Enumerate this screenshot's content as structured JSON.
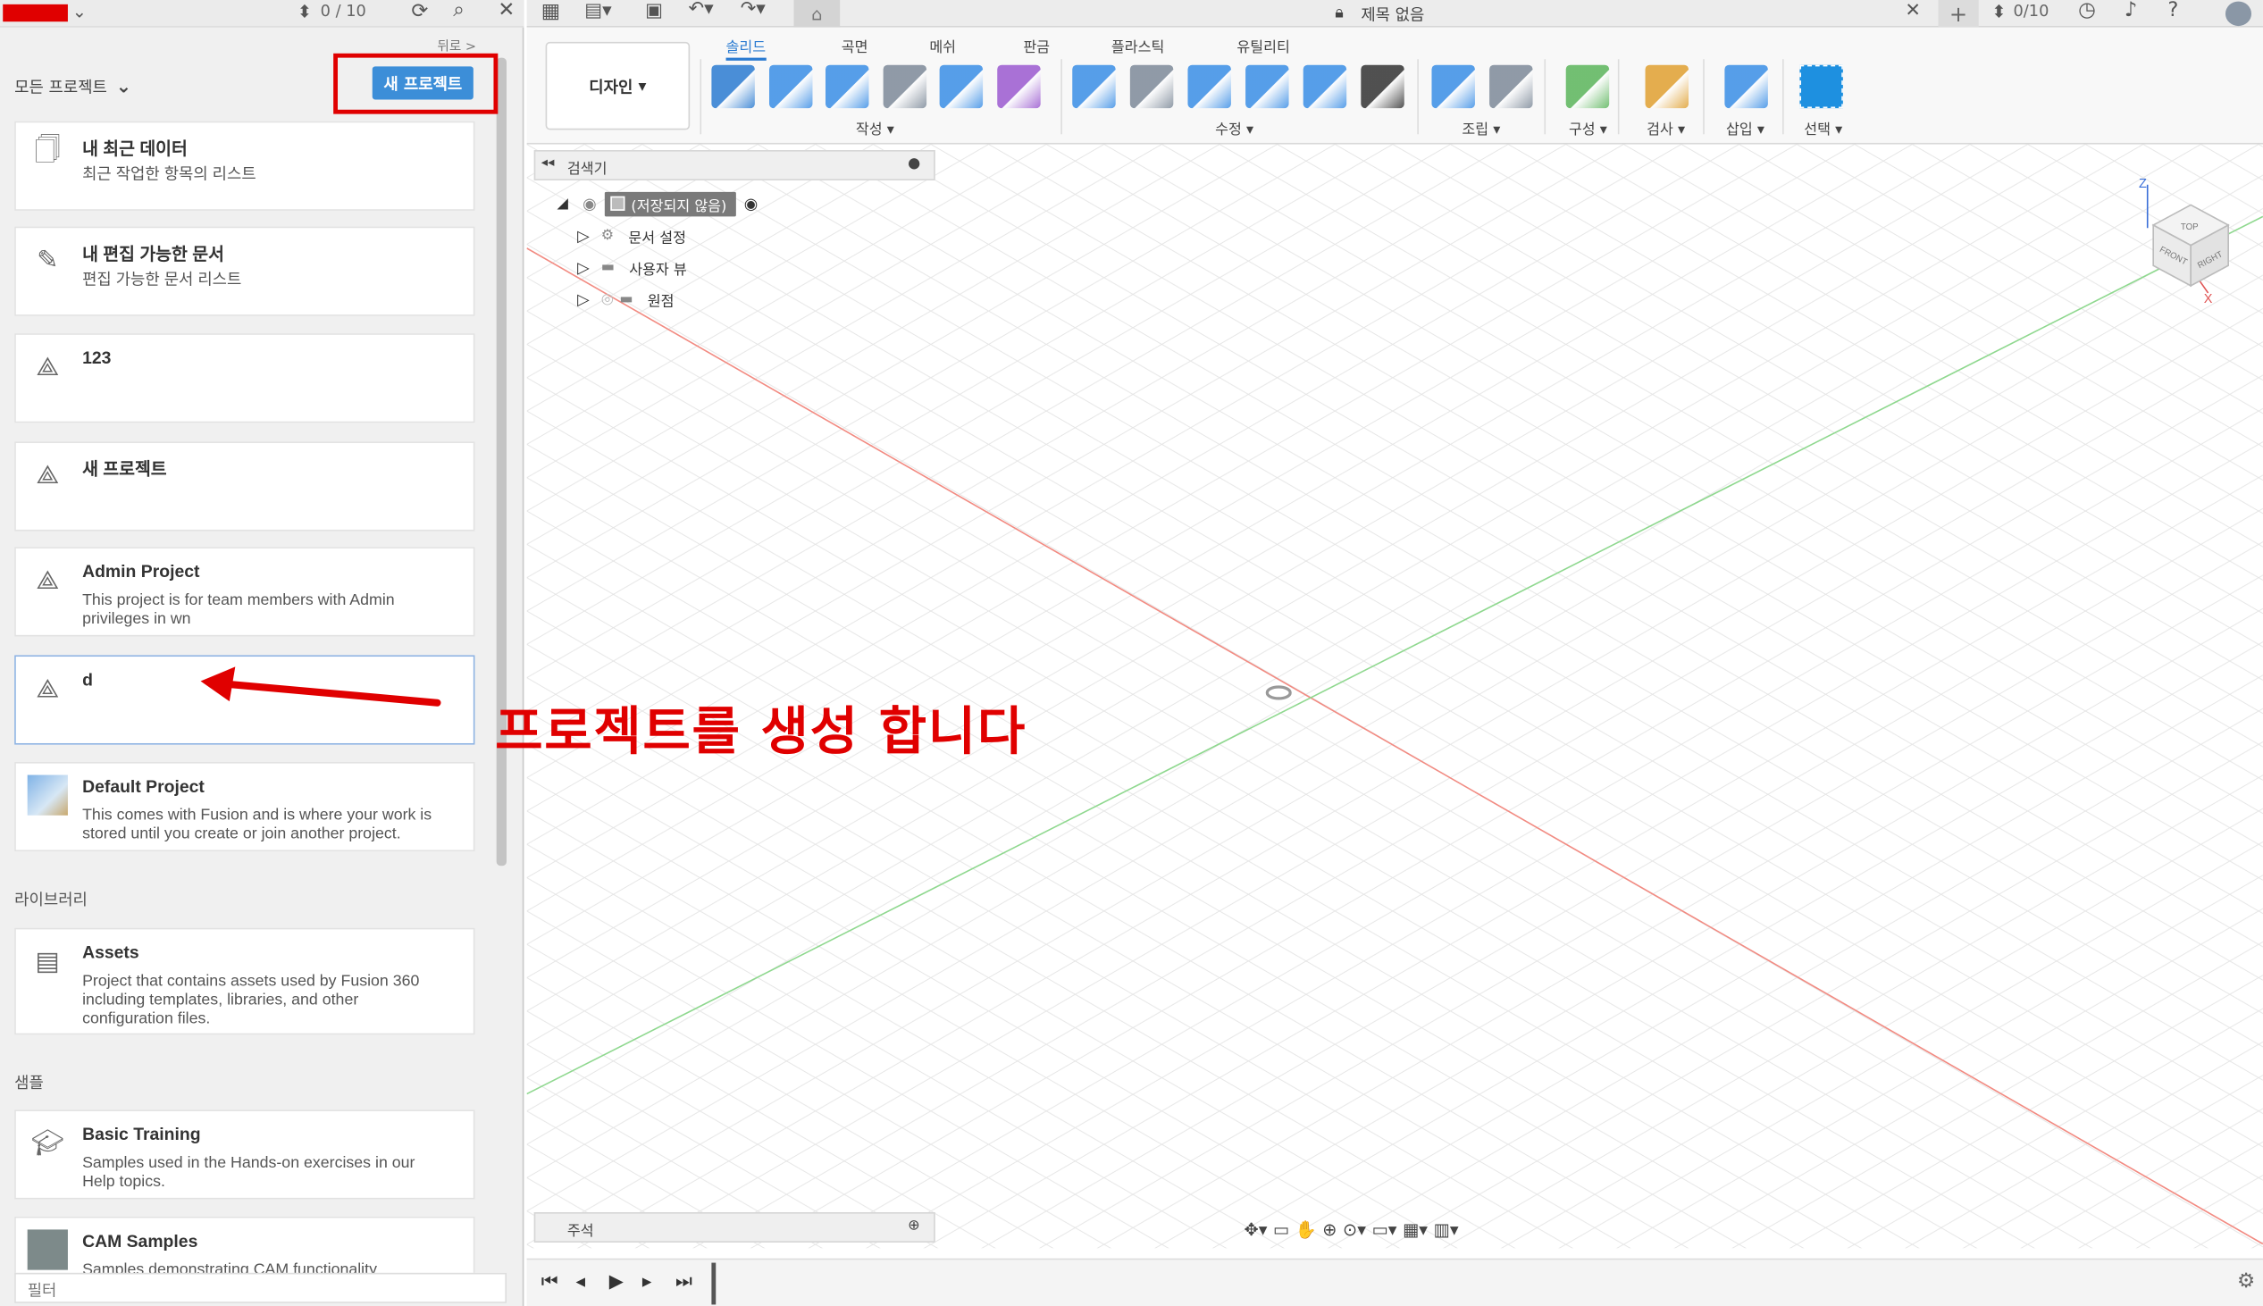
{
  "app_bar": {
    "job_count": "0 / 10",
    "back_label": "뒤로 >",
    "doc_title": "제목 없음",
    "right_job_count": "0/10"
  },
  "data_panel": {
    "project_filter": "모든 프로젝트",
    "new_project_button": "새 프로젝트",
    "projects": [
      {
        "title": "내 최근 데이터",
        "desc": "최근 작업한 항목의 리스트",
        "icon": "recent-docs-icon"
      },
      {
        "title": "내 편집 가능한 문서",
        "desc": "편집 가능한 문서 리스트",
        "icon": "edit-doc-icon"
      },
      {
        "title": "123",
        "desc": "",
        "icon": "project-icon"
      },
      {
        "title": "새 프로젝트",
        "desc": "",
        "icon": "project-icon"
      },
      {
        "title": "Admin Project",
        "desc": "This project is for team members with Admin privileges in wn",
        "icon": "project-icon"
      },
      {
        "title": "d",
        "desc": "",
        "icon": "project-icon"
      },
      {
        "title": "Default Project",
        "desc": "This comes with Fusion and is where your work is stored until you create or join another project.",
        "icon": "default-project-thumbnail"
      }
    ],
    "library_heading": "라이브러리",
    "library": [
      {
        "title": "Assets",
        "desc": "Project that contains assets used by Fusion 360 including templates, libraries, and other configuration files.",
        "icon": "archive-icon"
      }
    ],
    "samples_heading": "샘플",
    "samples": [
      {
        "title": "Basic Training",
        "desc": "Samples used in the Hands-on exercises in our Help topics.",
        "icon": "graduation-cap-icon"
      },
      {
        "title": "CAM Samples",
        "desc": "Samples demonstrating CAM functionality",
        "icon": "cam-thumbnail"
      }
    ],
    "filter_placeholder": "필터"
  },
  "ribbon": {
    "workspace": "디자인",
    "tabs": [
      "솔리드",
      "곡면",
      "메쉬",
      "판금",
      "플라스틱",
      "유틸리티"
    ],
    "active_tab": "솔리드",
    "groups": [
      "작성",
      "수정",
      "조립",
      "구성",
      "검사",
      "삽입",
      "선택"
    ]
  },
  "browser": {
    "title": "검색기",
    "root": "(저장되지 않음)",
    "items": [
      "문서 설정",
      "사용자 뷰",
      "원점"
    ]
  },
  "comments": {
    "title": "주석"
  },
  "annotation": {
    "text": "프로젝트를 생성 합니다"
  },
  "viewcube": {
    "top": "TOP",
    "front": "FRONT",
    "right": "RIGHT"
  },
  "colors": {
    "accent": "#3c8ed8",
    "annotation_red": "#e00000",
    "x_axis": "#f28b82",
    "y_axis": "#8fd88f"
  }
}
